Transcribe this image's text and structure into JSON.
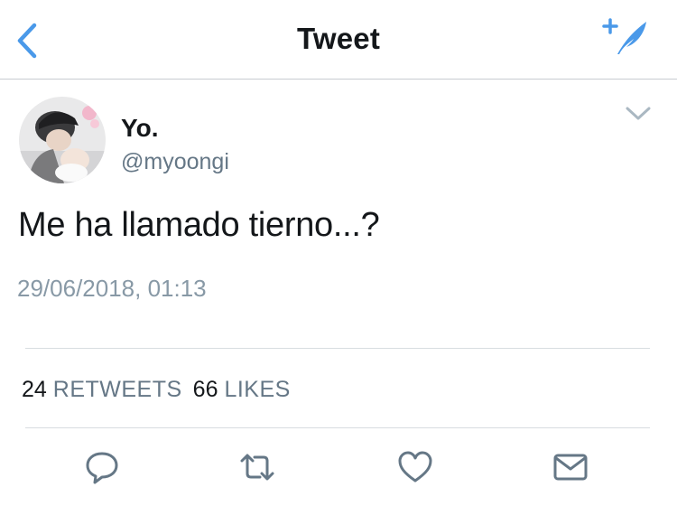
{
  "header": {
    "title": "Tweet",
    "back_icon": "chevron-left-icon",
    "compose_icon": "compose-feather-icon",
    "accent_color": "#4a99e9"
  },
  "tweet": {
    "author_name": "Yo.",
    "author_handle": "@myoongi",
    "text": "Me ha llamado tierno...?",
    "timestamp": "29/06/2018, 01:13",
    "retweet_count": "24",
    "retweet_label": "RETWEETS",
    "like_count": "66",
    "like_label": "LIKES"
  },
  "actions": [
    {
      "icon": "reply-icon"
    },
    {
      "icon": "retweet-icon"
    },
    {
      "icon": "heart-icon"
    },
    {
      "icon": "envelope-icon"
    }
  ],
  "colors": {
    "text_primary": "#14171a",
    "text_secondary": "#657786",
    "divider": "#d8dde1",
    "icon_gray": "#657786"
  }
}
